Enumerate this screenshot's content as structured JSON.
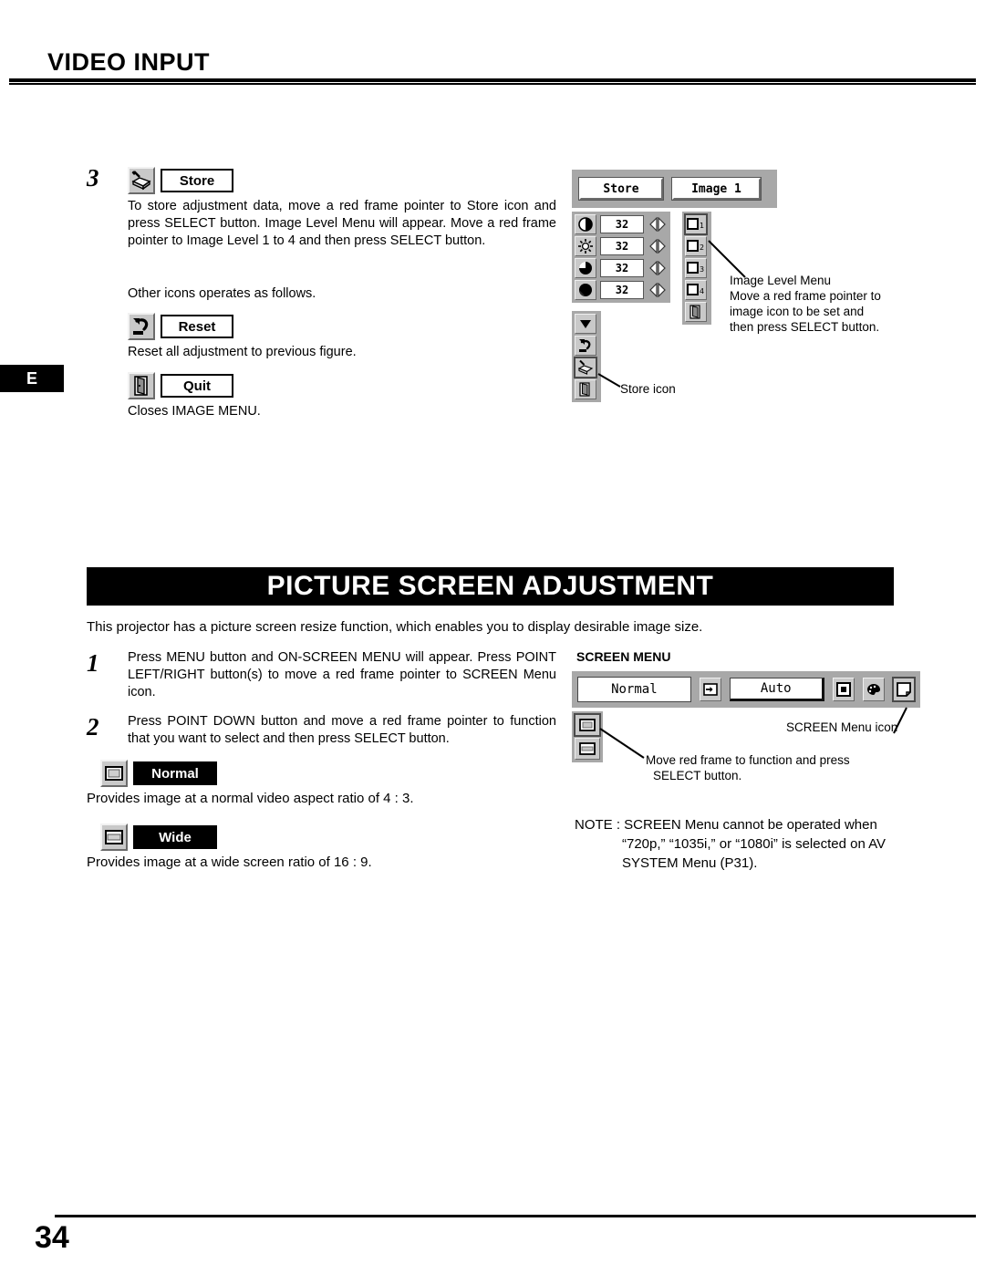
{
  "header": {
    "title": "VIDEO INPUT"
  },
  "margin_tab": {
    "label": "E"
  },
  "footer": {
    "page_number": "34"
  },
  "section1": {
    "step_number": "3",
    "store_button": {
      "label": "Store",
      "icon": "store-icon"
    },
    "store_text": "To store adjustment data, move a red frame pointer to Store icon and press SELECT button.  Image Level Menu will appear. Move a red frame pointer to Image Level 1 to 4 and then press SELECT button.",
    "other_icons_text": "Other icons operates as follows.",
    "reset_button": {
      "label": "Reset",
      "icon": "reset-icon"
    },
    "reset_text": "Reset all adjustment to previous figure.",
    "quit_button": {
      "label": "Quit",
      "icon": "quit-door-icon"
    },
    "quit_text": "Closes IMAGE MENU."
  },
  "image_menu_osd": {
    "store_tab": "Store",
    "image_tab": "Image 1",
    "adjust_values": [
      "32",
      "32",
      "32",
      "32"
    ],
    "adjust_icons": [
      "contrast-icon",
      "brightness-icon",
      "color-icon",
      "tint-icon"
    ],
    "extra_icons": [
      "down-arrow-icon",
      "reset-icon",
      "store-icon",
      "quit-door-icon"
    ],
    "level_icons": [
      "image-level-1-icon",
      "image-level-2-icon",
      "image-level-3-icon",
      "image-level-4-icon",
      "quit-door-icon"
    ],
    "level_labels": [
      "1",
      "2",
      "3",
      "4"
    ],
    "callout_image_level": "Image Level Menu\nMove a red frame pointer to\nimage icon to be set and\nthen press SELECT button.",
    "callout_image_level_lines": [
      "Image Level Menu",
      "Move a red frame pointer to",
      "image icon to be set and",
      "then press SELECT button."
    ],
    "callout_store_icon": "Store icon"
  },
  "section2": {
    "banner_title": "PICTURE SCREEN ADJUSTMENT",
    "intro": "This projector has a picture screen resize function, which enables you to display desirable image size.",
    "steps": [
      {
        "number": "1",
        "text": "Press MENU button and ON-SCREEN MENU will appear.  Press POINT LEFT/RIGHT button(s) to move a red frame pointer to SCREEN Menu icon."
      },
      {
        "number": "2",
        "text": "Press POINT DOWN button and move a red frame pointer to function that you want to select and then press SELECT button."
      }
    ],
    "normal_button": {
      "label": "Normal",
      "icon": "screen-normal-icon"
    },
    "normal_text": "Provides image at a normal video aspect ratio of 4 : 3.",
    "wide_button": {
      "label": "Wide",
      "icon": "screen-wide-icon"
    },
    "wide_text": "Provides image at a wide screen ratio of 16 : 9."
  },
  "screen_menu_osd": {
    "heading": "SCREEN MENU",
    "field_value": "Normal",
    "auto_value": "Auto",
    "bar_icons": [
      "input-icon",
      "square-icon",
      "color-palette-icon",
      "screen-menu-icon"
    ],
    "function_icons": [
      "screen-normal-icon",
      "screen-wide-icon"
    ],
    "callout_screen_icon": "SCREEN Menu icon",
    "callout_move_lines": [
      "Move red frame to function and press",
      "SELECT button."
    ],
    "note_lines": [
      "NOTE : SCREEN Menu cannot be operated when",
      "“720p,” “1035i,” or “1080i” is selected on AV",
      "SYSTEM Menu (P31)."
    ]
  },
  "colors": {
    "osd_gray": "#a8a8a8",
    "icon_gray": "#c9c9c9",
    "ink": "#000000"
  }
}
